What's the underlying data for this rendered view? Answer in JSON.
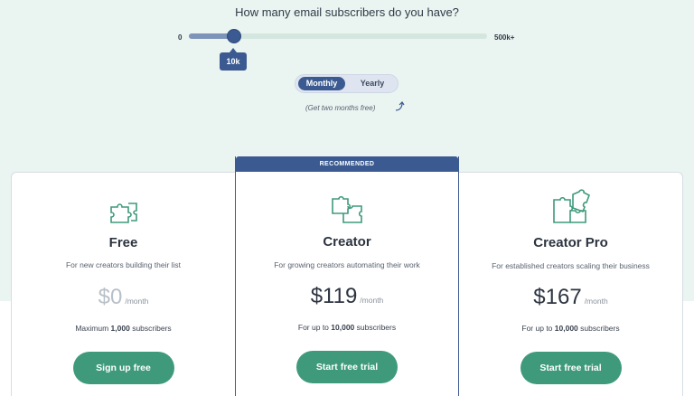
{
  "slider": {
    "question": "How many email subscribers do you have?",
    "min_label": "0",
    "max_label": "500k+",
    "value_label": "10k",
    "fill_fraction": 0.15
  },
  "billing": {
    "options": [
      "Monthly",
      "Yearly"
    ],
    "selected": "Monthly",
    "note": "(Get two months free)"
  },
  "colors": {
    "accent_blue": "#3b5a91",
    "cta_green": "#3f9a7c",
    "background_mint": "#eaf4f1"
  },
  "plans": [
    {
      "name": "Free",
      "icon": "puzzle-icon",
      "description": "For new creators building their list",
      "price": "$0",
      "period": "/month",
      "limit_prefix": "Maximum ",
      "limit_value": "1,000",
      "limit_suffix": " subscribers",
      "cta": "Sign up free"
    },
    {
      "name": "Creator",
      "icon": "puzzle-pieces-icon",
      "badge": "RECOMMENDED",
      "description": "For growing creators automating their work",
      "price": "$119",
      "period": "/month",
      "limit_prefix": "For up to ",
      "limit_value": "10,000",
      "limit_suffix": " subscribers",
      "cta": "Start free trial"
    },
    {
      "name": "Creator Pro",
      "icon": "puzzle-complete-icon",
      "description": "For established creators scaling their business",
      "price": "$167",
      "period": "/month",
      "limit_prefix": "For up to ",
      "limit_value": "10,000",
      "limit_suffix": " subscribers",
      "cta": "Start free trial"
    }
  ]
}
